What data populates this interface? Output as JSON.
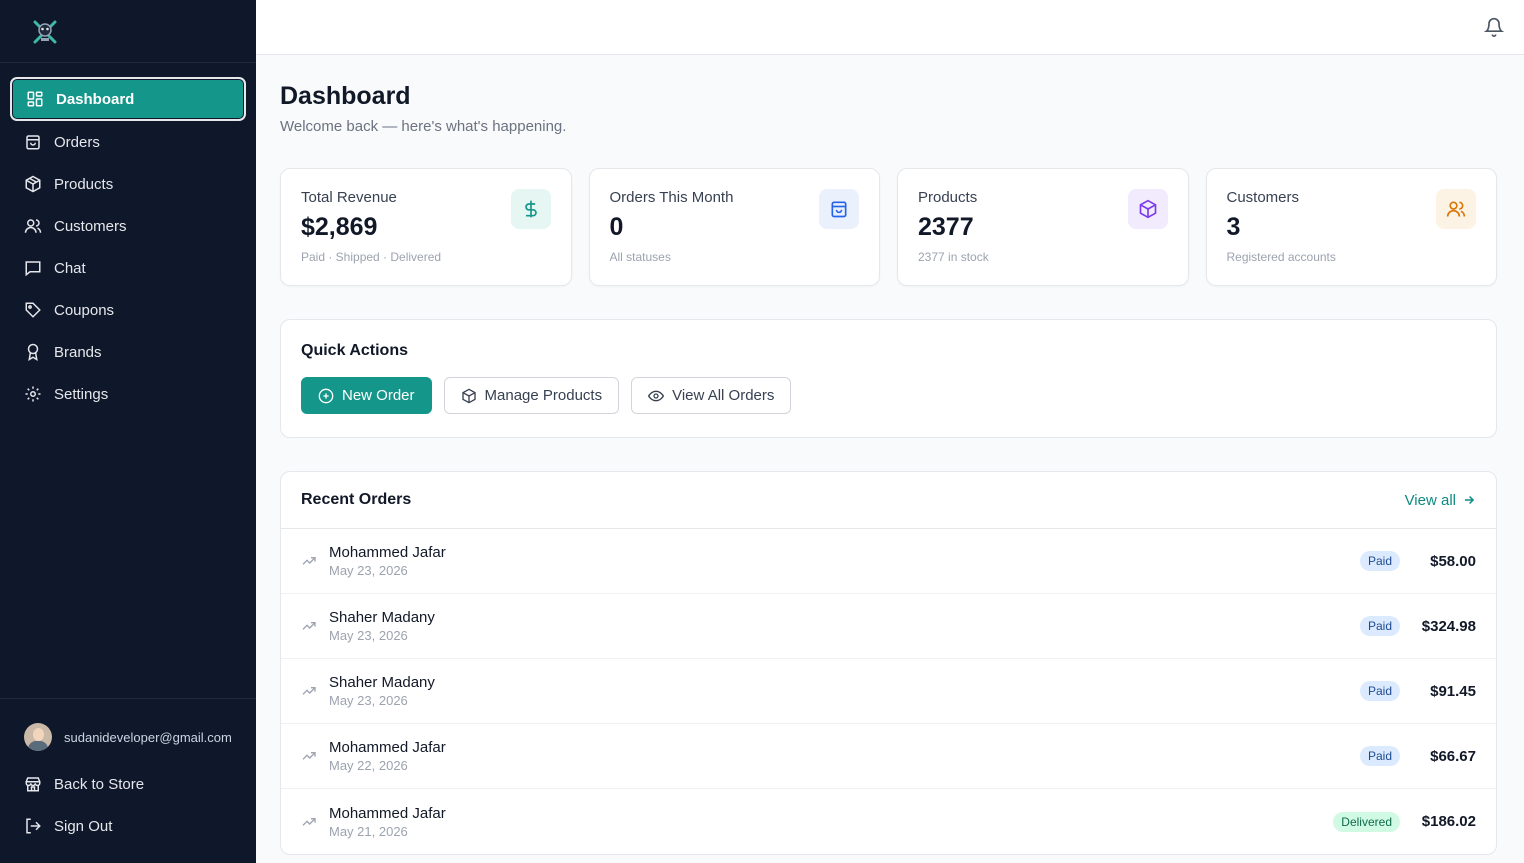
{
  "sidebar": {
    "items": [
      {
        "label": "Dashboard",
        "icon": "grid-icon",
        "active": true
      },
      {
        "label": "Orders",
        "icon": "shopping-bag-icon"
      },
      {
        "label": "Products",
        "icon": "package-icon"
      },
      {
        "label": "Customers",
        "icon": "users-icon"
      },
      {
        "label": "Chat",
        "icon": "message-square-icon"
      },
      {
        "label": "Coupons",
        "icon": "tag-icon"
      },
      {
        "label": "Brands",
        "icon": "award-icon"
      },
      {
        "label": "Settings",
        "icon": "gear-icon"
      }
    ],
    "user_email": "sudanideveloper@gmail.com",
    "back_label": "Back to Store",
    "signout_label": "Sign Out"
  },
  "header": {
    "title": "Dashboard",
    "subtitle": "Welcome back — here's what's happening."
  },
  "stats": [
    {
      "label": "Total Revenue",
      "value": "$2,869",
      "note": "Paid · Shipped · Delivered",
      "icon": "dollar-icon",
      "color": "#15968a",
      "bg": "#e6f6f3"
    },
    {
      "label": "Orders This Month",
      "value": "0",
      "note": "All statuses",
      "icon": "shopping-bag-icon",
      "color": "#2563eb",
      "bg": "#eaf1fd"
    },
    {
      "label": "Products",
      "value": "2377",
      "note": "2377 in stock",
      "icon": "package-icon",
      "color": "#7c3aed",
      "bg": "#f1ebfd"
    },
    {
      "label": "Customers",
      "value": "3",
      "note": "Registered accounts",
      "icon": "users-icon",
      "color": "#d97706",
      "bg": "#fdf3e4"
    }
  ],
  "quick_actions": {
    "title": "Quick Actions",
    "new_order": "New Order",
    "manage_products": "Manage Products",
    "view_all_orders": "View All Orders"
  },
  "recent_orders": {
    "title": "Recent Orders",
    "view_all": "View all",
    "rows": [
      {
        "name": "Mohammed Jafar",
        "date": "May 23, 2026",
        "status": "Paid",
        "amount": "$58.00"
      },
      {
        "name": "Shaher Madany",
        "date": "May 23, 2026",
        "status": "Paid",
        "amount": "$324.98"
      },
      {
        "name": "Shaher Madany",
        "date": "May 23, 2026",
        "status": "Paid",
        "amount": "$91.45"
      },
      {
        "name": "Mohammed Jafar",
        "date": "May 22, 2026",
        "status": "Paid",
        "amount": "$66.67"
      },
      {
        "name": "Mohammed Jafar",
        "date": "May 21, 2026",
        "status": "Delivered",
        "amount": "$186.02"
      }
    ]
  },
  "colors": {
    "accent": "#15968a",
    "sidebar_bg": "#0f172a"
  }
}
